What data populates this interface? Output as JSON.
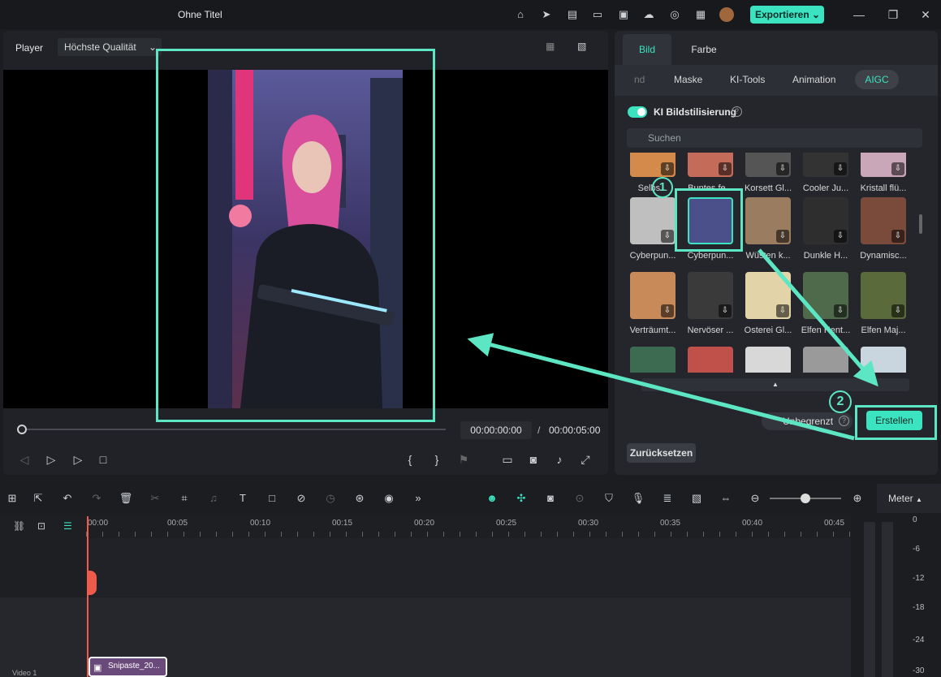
{
  "app": {
    "title": "Ohne Titel",
    "export_label": "Exportieren"
  },
  "player": {
    "label": "Player",
    "quality": "Höchste Qualität",
    "timecode_current": "00:00:00:00",
    "timecode_separator": "/",
    "timecode_total": "00:00:05:00",
    "progress": 0
  },
  "panel": {
    "tabs": [
      "Bild",
      "Farbe"
    ],
    "subtabs": [
      "nd",
      "Maske",
      "KI-Tools",
      "Animation",
      "AIGC"
    ],
    "active_subtab": "AIGC",
    "toggle_label": "KI Bildstilisierung",
    "toggle_on": true,
    "search_placeholder": "Suchen",
    "styles_row0": [
      "Selbs...",
      "Buntes fe...",
      "Korsett Gl...",
      "Cooler Ju...",
      "Kristall flü..."
    ],
    "styles_row1": [
      "Cyberpun...",
      "Cyberpun...",
      "Wüsten k...",
      "Dunkle H...",
      "Dynamisc..."
    ],
    "styles_row2": [
      "Verträumt...",
      "Nervöser ...",
      "Osterei Gl...",
      "Elfen Hent...",
      "Elfen Maj..."
    ],
    "selected_style": "Cyberpun...",
    "annotation_1": "1",
    "annotation_2": "2",
    "unlimited_label": "Unbegrenzt",
    "create_label": "Erstellen",
    "reset_label": "Zurücksetzen"
  },
  "timeline": {
    "ruler": [
      "00:00",
      "00:05",
      "00:10",
      "00:15",
      "00:20",
      "00:25",
      "00:30",
      "00:35",
      "00:40",
      "00:45"
    ],
    "meter_label": "Meter",
    "meter_scale": [
      "0",
      "-6",
      "-12",
      "-18",
      "-24",
      "-30"
    ],
    "clip_label": "Snipaste_20...",
    "track_label": "Video 1"
  },
  "colors": {
    "accent": "#3ce3c0",
    "annotation": "#5de6c4",
    "playhead": "#f05a4a"
  }
}
